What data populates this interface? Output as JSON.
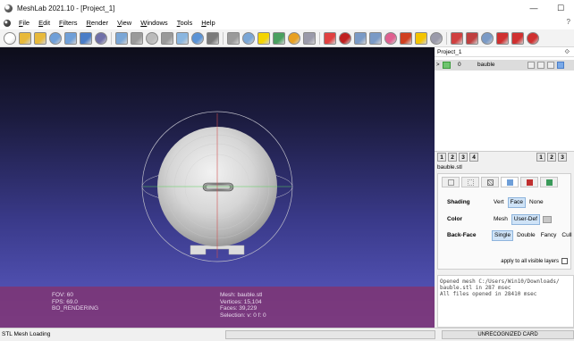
{
  "window": {
    "title": "MeshLab 2021.10 - [Project_1]",
    "minimize": "—",
    "maximize": "☐"
  },
  "menu": {
    "items": [
      "File",
      "Edit",
      "Filters",
      "Render",
      "View",
      "Windows",
      "Tools",
      "Help"
    ],
    "help_corner": "?"
  },
  "toolbar": {
    "icons": [
      {
        "name": "new-project-icon",
        "color": "#ffffff"
      },
      {
        "name": "open-project-icon",
        "color": "#e8b93a"
      },
      {
        "name": "import-mesh-icon",
        "color": "#e8b93a"
      },
      {
        "name": "reload-icon",
        "color": "#6f9fd8"
      },
      {
        "name": "reload-all-icon",
        "color": "#6f9fd8"
      },
      {
        "name": "export-mesh-icon",
        "color": "#4a7dc7"
      },
      {
        "name": "snapshot-icon",
        "color": "#6f6fa8"
      },
      {
        "name": "layers-icon",
        "color": "#7aa6d6"
      },
      {
        "name": "bbox-icon",
        "color": "#9a9a9a"
      },
      {
        "name": "points-icon",
        "color": "#bbbbbb"
      },
      {
        "name": "wireframe-icon",
        "color": "#999999"
      },
      {
        "name": "flat-icon",
        "color": "#8ab6e0"
      },
      {
        "name": "smooth-icon",
        "color": "#5a93d6"
      },
      {
        "name": "lighting-icon",
        "color": "#7a7a7a"
      },
      {
        "name": "cross-hair-icon",
        "color": "#9a9a9a"
      },
      {
        "name": "align-icon",
        "color": "#7aa6d6"
      },
      {
        "name": "annotation-icon",
        "color": "#f4d400"
      },
      {
        "name": "measure-icon",
        "color": "#4aa060"
      },
      {
        "name": "paint-icon",
        "color": "#e8a020"
      },
      {
        "name": "select-faces-icon",
        "color": "#9a9aaa"
      },
      {
        "name": "brush-icon",
        "color": "#e04040"
      },
      {
        "name": "texture-icon",
        "color": "#c02020"
      },
      {
        "name": "select-vertices-icon",
        "color": "#7a9ac6"
      },
      {
        "name": "select-connected-icon",
        "color": "#7a9ac6"
      },
      {
        "name": "color-paint-icon",
        "color": "#e06090"
      },
      {
        "name": "pick-icon",
        "color": "#d04020"
      },
      {
        "name": "info-icon",
        "color": "#f4c400"
      },
      {
        "name": "fill-hole-icon",
        "color": "#9a9aaa"
      },
      {
        "name": "select-all-icon",
        "color": "#d04040"
      },
      {
        "name": "select-none-icon",
        "color": "#c04040"
      },
      {
        "name": "invert-selection-icon",
        "color": "#7a9ac6"
      },
      {
        "name": "delete-faces-icon",
        "color": "#d03030"
      },
      {
        "name": "delete-vertices-icon",
        "color": "#d03030"
      },
      {
        "name": "delete-all-icon",
        "color": "#d03030"
      }
    ]
  },
  "viewport": {
    "info_left": [
      "FOV: 60",
      "FPS:   69.0",
      "BO_RENDERING"
    ],
    "info_right": [
      "Mesh: bauble.stl",
      "Vertices: 15,104",
      "Faces: 39,229",
      "Selection: v: 0 f: 0"
    ],
    "colors": {
      "sphere": "#d8d8d8",
      "trackball": "#cfcfcf",
      "axis_red": "#d05050",
      "axis_green": "#50d050"
    }
  },
  "project": {
    "name": "Project_1",
    "header_icon": "⟐"
  },
  "layers": [
    {
      "arrow": ">",
      "id": "0",
      "name": "bauble"
    }
  ],
  "layer_numbers_left": [
    "1",
    "2",
    "3",
    "4"
  ],
  "layer_numbers_right": [
    "1",
    "2",
    "3"
  ],
  "current_file": "bauble.stl",
  "render": {
    "shading_label": "Shading",
    "shading_options": [
      "Vert",
      "Face",
      "None"
    ],
    "shading_selected": "Face",
    "color_label": "Color",
    "color_options": [
      "Mesh",
      "User-Def"
    ],
    "color_selected": "User-Def",
    "backface_label": "Back-Face",
    "backface_options": [
      "Single",
      "Double",
      "Fancy",
      "Cull"
    ],
    "backface_selected": "Single",
    "apply_label": "apply to all visible layers"
  },
  "log": "Opened mesh C:/Users/Win10/Downloads/\nbauble.stl in 287 msec\nAll files opened in 28410 msec",
  "status": {
    "message": "STL Mesh Loading",
    "card": "UNRECOGNIZED CARD"
  }
}
